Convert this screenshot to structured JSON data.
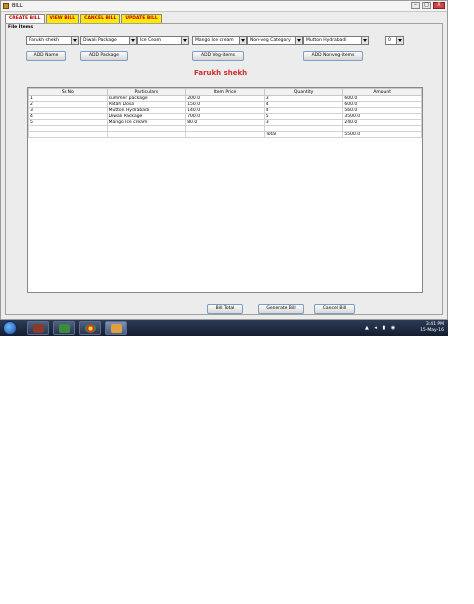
{
  "window": {
    "title": "BILL",
    "buttons": {
      "minimize": "–",
      "maximize": "□",
      "close": "X"
    }
  },
  "tabs": [
    {
      "label": "CREATE BILL",
      "active": true
    },
    {
      "label": "VIEW BILL"
    },
    {
      "label": "CANCEL BILL"
    },
    {
      "label": "UPDATE BILL"
    }
  ],
  "panel_label": "File Items",
  "selectors": {
    "name": "Farukh shekh",
    "package": "Diwali Package",
    "veg": "Ice Ceam",
    "dessert": "Mango Ice cream",
    "nonveg_category": "Non-veg Category",
    "nonveg_item": "Mutton Hydrabadi",
    "quantity": "0"
  },
  "buttons": {
    "add_name": "ADD Name",
    "add_package": "ADD Package",
    "add_veg": "ADD Veg-items",
    "add_nonveg": "ADD Nonveg-items",
    "bill_total": "Bill Total",
    "generate_bill": "Generate Bill",
    "cancel_bill": "Cancel Bill"
  },
  "customer_name": "Farukh shekh",
  "bill_table": {
    "columns": [
      "Sr.No",
      "Particulars",
      "Item Price",
      "Quantity",
      "Amount"
    ],
    "rows": [
      [
        "1",
        "summer package",
        "200.0",
        "3",
        "600.0"
      ],
      [
        "2",
        "Patah Dosa",
        "150.0",
        "4",
        "600.0"
      ],
      [
        "3",
        "Mutton Hydrabadi",
        "140.0",
        "4",
        "560.0"
      ],
      [
        "4",
        "Diwali Package",
        "700.0",
        "5",
        "3500.0"
      ],
      [
        "5",
        "Mango Ice cream",
        "80.0",
        "3",
        "240.0"
      ],
      [
        "",
        "",
        "",
        "",
        ""
      ],
      [
        "",
        "",
        "",
        "Total",
        "5500.0"
      ]
    ]
  },
  "taskbar": {
    "time": "3:41 PM",
    "date": "15-May-16"
  },
  "colors": {
    "tab_bg": "#ffea00",
    "tab_text": "#c00000",
    "customer_name": "#d12b2b",
    "taskbar": "#1c2740"
  }
}
